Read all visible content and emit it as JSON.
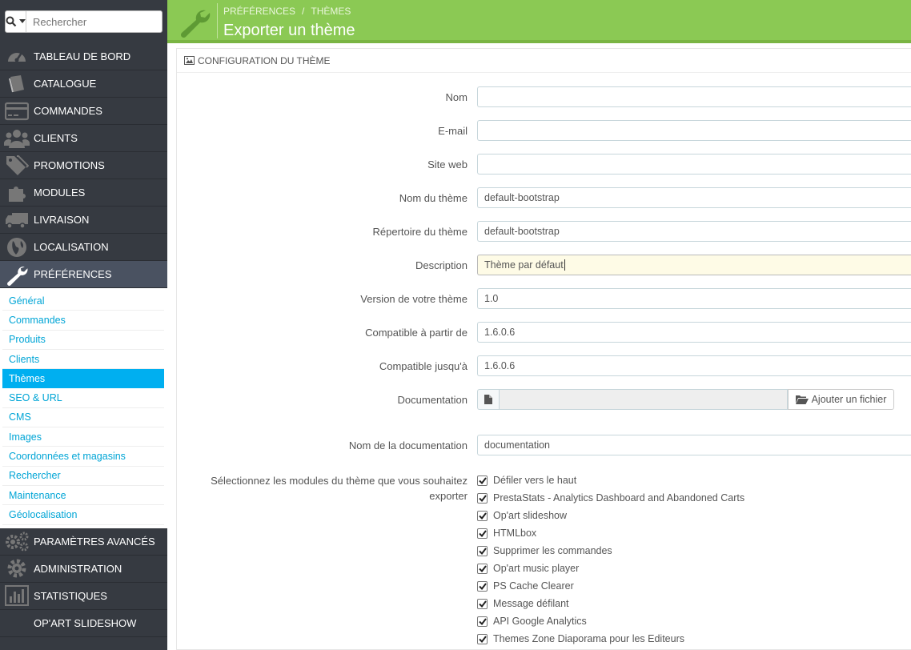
{
  "search": {
    "placeholder": "Rechercher"
  },
  "menu_top": [
    {
      "label": "TABLEAU DE BORD",
      "icon": "dashboard-icon"
    },
    {
      "label": "CATALOGUE",
      "icon": "book-icon"
    },
    {
      "label": "COMMANDES",
      "icon": "credit-card-icon"
    },
    {
      "label": "CLIENTS",
      "icon": "users-icon"
    },
    {
      "label": "PROMOTIONS",
      "icon": "tags-icon"
    },
    {
      "label": "MODULES",
      "icon": "puzzle-icon"
    },
    {
      "label": "LIVRAISON",
      "icon": "truck-icon"
    },
    {
      "label": "LOCALISATION",
      "icon": "globe-icon"
    },
    {
      "label": "PRÉFÉRENCES",
      "icon": "wrench-icon"
    }
  ],
  "submenu": [
    "Général",
    "Commandes",
    "Produits",
    "Clients",
    "Thèmes",
    "SEO & URL",
    "CMS",
    "Images",
    "Coordonnées et magasins",
    "Rechercher",
    "Maintenance",
    "Géolocalisation"
  ],
  "submenu_active_index": 4,
  "menu_bottom": [
    {
      "label": "PARAMÈTRES AVANCÉS",
      "icon": "cogs-icon"
    },
    {
      "label": "ADMINISTRATION",
      "icon": "cog-icon"
    },
    {
      "label": "STATISTIQUES",
      "icon": "bar-chart-icon"
    },
    {
      "label": "OP'ART SLIDESHOW",
      "icon": ""
    }
  ],
  "header": {
    "breadcrumb": [
      "PRÉFÉRENCES",
      "THÈMES"
    ],
    "title": "Exporter un thème",
    "accent": "#8bc954"
  },
  "panel": {
    "heading": "CONFIGURATION DU THÈME",
    "fields": {
      "nom": {
        "label": "Nom",
        "value": ""
      },
      "email": {
        "label": "E-mail",
        "value": ""
      },
      "site_web": {
        "label": "Site web",
        "value": ""
      },
      "nom_theme": {
        "label": "Nom du thème",
        "value": "default-bootstrap"
      },
      "repertoire": {
        "label": "Répertoire du thème",
        "value": "default-bootstrap"
      },
      "description": {
        "label": "Description",
        "value": "Thème par défaut"
      },
      "version": {
        "label": "Version de votre thème",
        "value": "1.0"
      },
      "compat_from": {
        "label": "Compatible à partir de",
        "value": "1.6.0.6"
      },
      "compat_to": {
        "label": "Compatible jusqu'à",
        "value": "1.6.0.6"
      },
      "documentation": {
        "label": "Documentation",
        "button": "Ajouter un fichier"
      },
      "doc_name": {
        "label": "Nom de la documentation",
        "value": "documentation"
      }
    },
    "modules_label": "Sélectionnez les modules du thème que vous souhaitez exporter",
    "modules": [
      "Défiler vers le haut",
      "PrestaStats - Analytics Dashboard and Abandoned Carts",
      "Op'art slideshow",
      "HTMLbox",
      "Supprimer les commandes",
      "Op'art music player",
      "PS Cache Clearer",
      "Message défilant",
      "API Google Analytics",
      "Themes Zone Diaporama pour les Editeurs"
    ]
  }
}
